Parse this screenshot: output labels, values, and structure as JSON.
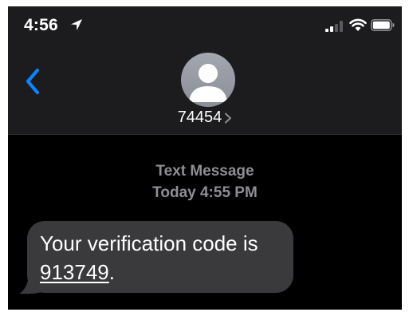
{
  "status_bar": {
    "time": "4:56",
    "icons": [
      "location-arrow-icon",
      "cellular-signal-icon",
      "wifi-icon",
      "battery-icon"
    ]
  },
  "conversation": {
    "back_icon": "chevron-left-icon",
    "avatar_icon": "person-silhouette-icon",
    "contact_number": "74454",
    "contact_chevron_icon": "chevron-right-icon"
  },
  "thread": {
    "message_type": "Text Message",
    "timestamp": "Today 4:55 PM",
    "messages": [
      {
        "direction": "incoming",
        "text_prefix": "Your verification code is ",
        "code": "913749",
        "text_suffix": "."
      }
    ]
  },
  "colors": {
    "background": "#000000",
    "header_background": "#1c1c1e",
    "incoming_bubble": "#3a3a3c",
    "accent_blue": "#0a84ff",
    "meta_gray": "#8e8e93"
  }
}
